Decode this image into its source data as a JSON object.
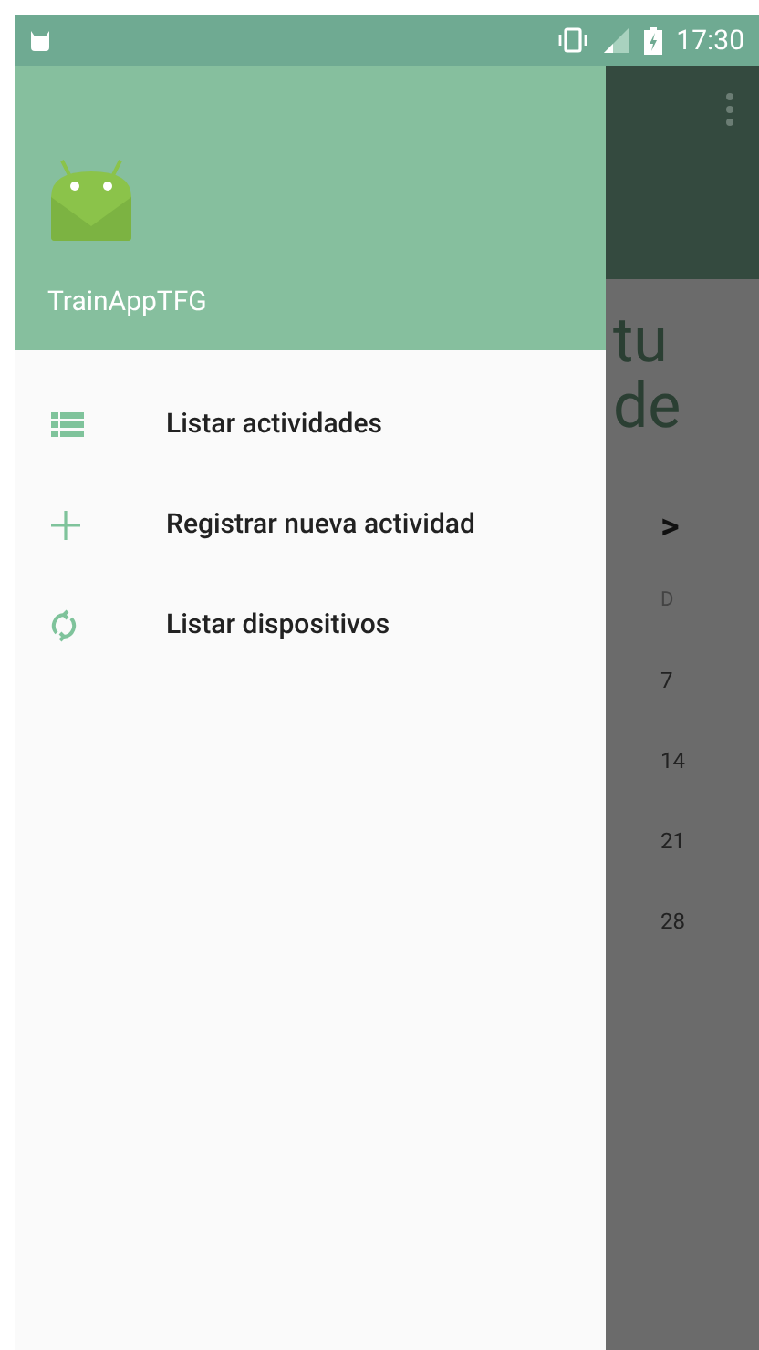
{
  "status_bar": {
    "time": "17:30"
  },
  "drawer": {
    "app_name": "TrainAppTFG",
    "items": [
      {
        "kind": "list",
        "label": "Listar actividades"
      },
      {
        "kind": "add",
        "label": "Registrar nueva actividad"
      },
      {
        "kind": "sync",
        "label": "Listar dispositivos"
      }
    ]
  },
  "background": {
    "heading_lines": [
      "tu",
      "de"
    ],
    "next": ">",
    "calendar_column": [
      "D",
      "7",
      "14",
      "21",
      "28"
    ]
  }
}
